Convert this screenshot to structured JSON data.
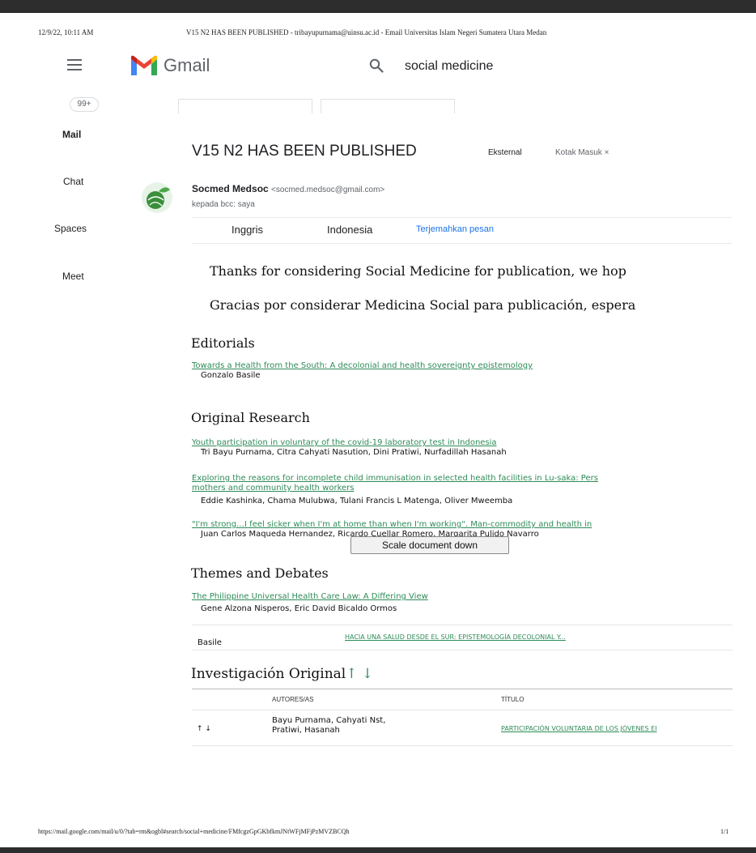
{
  "print_header": {
    "datetime": "12/9/22, 10:11 AM",
    "title": "V15 N2 HAS BEEN PUBLISHED - tribayupurnama@uinsu.ac.id - Email Universitas Islam Negeri Sumatera Utara Medan"
  },
  "app": {
    "name": "Gmail"
  },
  "search": {
    "query": "social medicine"
  },
  "sidebar": {
    "badge": "99+",
    "items": [
      {
        "label": "Mail"
      },
      {
        "label": "Chat"
      },
      {
        "label": "Spaces"
      },
      {
        "label": "Meet"
      }
    ]
  },
  "email": {
    "subject": "V15 N2 HAS BEEN PUBLISHED",
    "labels": {
      "external": "Eksternal",
      "inbox": "Kotak Masuk ×"
    },
    "sender_name": "Socmed Medsoc",
    "sender_email": "<socmed.medsoc@gmail.com>",
    "recipient": "kepada bcc: saya",
    "translate": {
      "lang_from": "Inggris",
      "lang_to": "Indonesia",
      "action": "Terjemahkan pesan"
    },
    "body": {
      "lead_en": "Thanks for considering Social Medicine for publication, we hop",
      "lead_es": "Gracias por considerar Medicina Social para publicación, espera",
      "sections": [
        {
          "title": "Editorials",
          "articles": [
            {
              "title": "Towards a Health from the South: A decolonial and health sovereignty epistemology",
              "authors": "Gonzalo Basile"
            }
          ]
        },
        {
          "title": "Original Research",
          "articles": [
            {
              "title": "Youth participation in voluntary of the covid-19 laboratory test in Indonesia",
              "authors": "Tri Bayu Purnama, Citra Cahyati Nasution, Dini Pratiwi, Nurfadillah Hasanah"
            },
            {
              "title": "Exploring the reasons for incomplete child immunisation in selected health facilities in Lu-saka: Pers",
              "title_cont": "mothers and community health workers",
              "authors": "Eddie Kashinka, Chama Mulubwa, Tulani Francis L Matenga, Oliver Mweemba"
            },
            {
              "title": "\"I'm strong…I feel sicker when I'm at home than when I'm working\". Man-commodity and health in",
              "authors": "Juan Carlos Maqueda Hernandez, Ricardo Cuellar Romero, Margarita Pulido Navarro"
            }
          ]
        },
        {
          "title": "Themes and Debates",
          "articles": [
            {
              "title": "The Philippine Universal Health Care Law: A Differing View",
              "authors": "Gene Alzona Nisperos, Eric David Bicaldo Ormos"
            }
          ]
        }
      ],
      "spanish_row": {
        "author": "Basile",
        "title": "HACIA UNA SALUD DESDE EL SUR: EPISTEMOLOGÍA DECOLONIAL Y..."
      },
      "investigacion": {
        "title": "Investigación Original",
        "arrows": "↑ ↓",
        "col_authors": "AUTORES/AS",
        "col_title": "TÍTULO",
        "row": {
          "arrows": "↑ ↓",
          "authors": "Bayu Purnama, Cahyati Nst, Pratiwi, Hasanah",
          "title": "PARTICIPACIÓN VOLUNTARIA DE LOS JÓVENES EI"
        }
      }
    }
  },
  "tooltip": "Scale document down",
  "print_footer": {
    "url": "https://mail.google.com/mail/u/0/?tab=rm&ogbl#search/social+medicine/FMfcgzGpGKbfkmJNtWFjMFjPzMVZBCQh",
    "page": "1/1"
  },
  "colors": {
    "link_green": "#2e8b57",
    "gmail_blue": "#1a73e8",
    "bar_dark": "#2d2d2d"
  },
  "icons": [
    "menu-icon",
    "gmail-logo",
    "search-icon",
    "sender-avatar"
  ]
}
